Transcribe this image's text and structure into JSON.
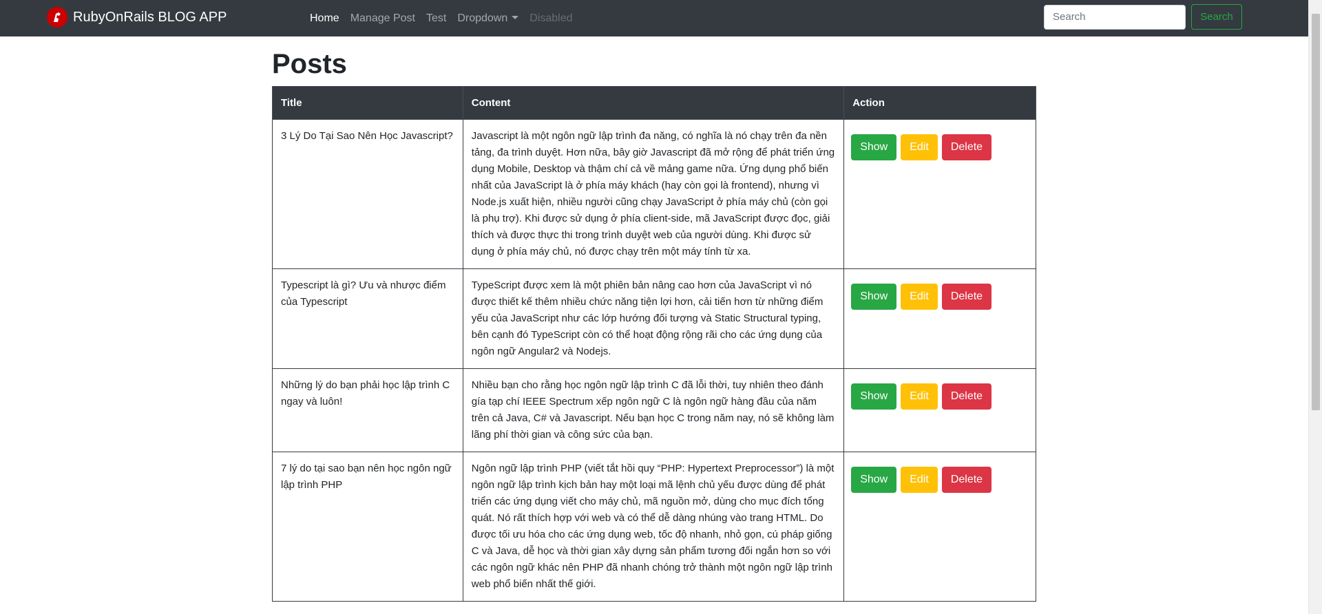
{
  "navbar": {
    "brand": "RubyOnRails BLOG APP",
    "links": [
      {
        "label": "Home",
        "state": "active"
      },
      {
        "label": "Manage Post",
        "state": "normal"
      },
      {
        "label": "Test",
        "state": "normal"
      },
      {
        "label": "Dropdown",
        "state": "dropdown"
      },
      {
        "label": "Disabled",
        "state": "disabled"
      }
    ],
    "search": {
      "placeholder": "Search",
      "value": "",
      "button_label": "Search"
    }
  },
  "main": {
    "title": "Posts",
    "table": {
      "headers": [
        "Title",
        "Content",
        "Action"
      ],
      "rows": [
        {
          "title": "3 Lý Do Tại Sao Nên Học Javascript?",
          "content": "Javascript là một ngôn ngữ lập trình đa năng, có nghĩa là nó chạy trên đa nền tảng, đa trình duyệt. Hơn nữa, bây giờ Javascript đã mở rộng để phát triển ứng dụng Mobile, Desktop và thậm chí cả về mảng game nữa. Ứng dụng phổ biến nhất của JavaScript là ở phía máy khách (hay còn gọi là frontend), nhưng vì Node.js xuất hiện, nhiều người cũng chạy JavaScript ở phía máy chủ (còn gọi là phụ trợ). Khi được sử dụng ở phía client-side, mã JavaScript được đọc, giải thích và được thực thi trong trình duyệt web của người dùng. Khi được sử dụng ở phía máy chủ, nó được chạy trên một máy tính từ xa."
        },
        {
          "title": "Typescript là gì? Ưu và nhược điểm của Typescript",
          "content": "TypeScript được xem là một phiên bản nâng cao hơn của JavaScript vì nó được thiết kế thêm nhiều chức năng tiện lợi hơn, cải tiến hơn từ những điểm yếu của JavaScript như các lớp hướng đối tượng và Static Structural typing, bên cạnh đó TypeScript còn có thể hoạt động rộng rãi cho các ứng dụng của ngôn ngữ Angular2 và Nodejs."
        },
        {
          "title": "Những lý do bạn phải học lập trình C ngay và luôn!",
          "content": "Nhiều bạn cho rằng học ngôn ngữ lập trình C đã lỗi thời, tuy nhiên theo đánh gía tạp chí IEEE Spectrum xếp ngôn ngữ C là ngôn ngữ hàng đầu của năm trên cả Java, C# và Javascript. Nếu bạn học C trong năm nay, nó sẽ không làm lãng phí thời gian và công sức của bạn."
        },
        {
          "title": "7 lý do tại sao bạn nên học ngôn ngữ lập trình PHP",
          "content": "Ngôn ngữ lập trình PHP (viết tắt hồi quy “PHP: Hypertext Preprocessor”) là một ngôn ngữ lập trình kịch bản hay một loại mã lệnh chủ yếu được dùng để phát triển các ứng dụng viết cho máy chủ, mã nguồn mở, dùng cho mục đích tổng quát. Nó rất thích hợp với web và có thể dễ dàng nhúng vào trang HTML. Do được tối ưu hóa cho các ứng dụng web, tốc độ nhanh, nhỏ gọn, cú pháp giống C và Java, dễ học và thời gian xây dựng sản phẩm tương đối ngắn hơn so với các ngôn ngữ khác nên PHP đã nhanh chóng trở thành một ngôn ngữ lập trình web phổ biến nhất thế giới."
        }
      ],
      "actions": {
        "show": "Show",
        "edit": "Edit",
        "delete": "Delete"
      }
    }
  },
  "colors": {
    "navbar_bg": "#343a40",
    "show": "#28a745",
    "edit": "#ffc107",
    "delete": "#dc3545",
    "logo": "#cc0000"
  },
  "icons": {
    "brand_logo": "rails-logo-icon",
    "dropdown": "chevron-down-icon"
  }
}
